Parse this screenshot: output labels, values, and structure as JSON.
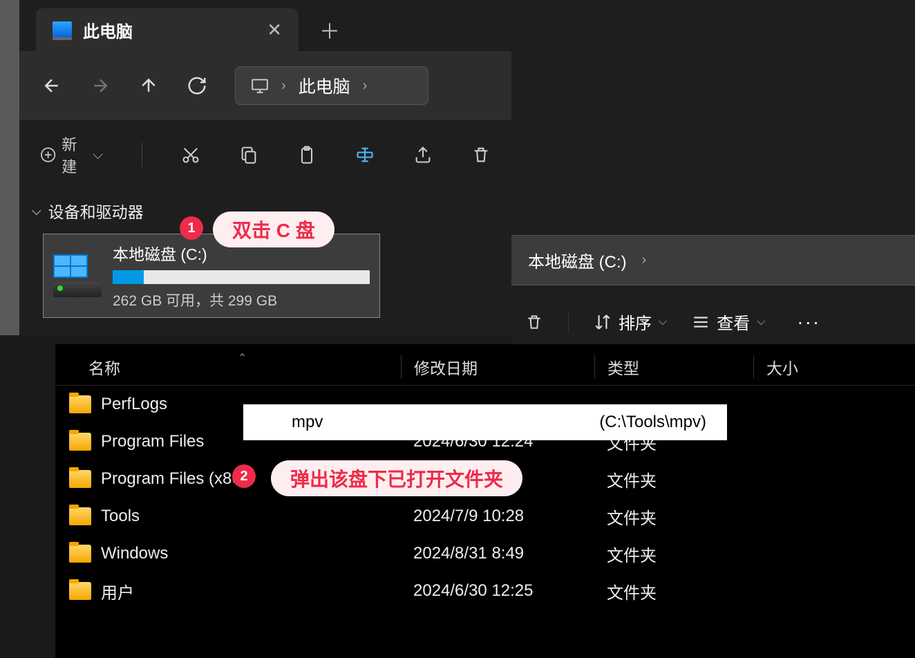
{
  "window1": {
    "tab_title": "此电脑",
    "breadcrumb": "此电脑",
    "toolbar": {
      "new_label": "新建"
    },
    "section_label": "设备和驱动器",
    "drive": {
      "name": "本地磁盘 (C:)",
      "subtitle": "262 GB 可用，共 299 GB"
    }
  },
  "window2": {
    "breadcrumb": "本地磁盘 (C:)",
    "toolbar": {
      "sort_label": "排序",
      "view_label": "查看"
    },
    "columns": {
      "name": "名称",
      "date": "修改日期",
      "type": "类型",
      "size": "大小"
    },
    "files": [
      {
        "name": "PerfLogs",
        "date": "",
        "type": ""
      },
      {
        "name": "Program Files",
        "date": "2024/6/30 12:24",
        "type": "文件夹"
      },
      {
        "name": "Program Files (x86)",
        "date": "",
        "type": "文件夹"
      },
      {
        "name": "Tools",
        "date": "2024/7/9 10:28",
        "type": "文件夹"
      },
      {
        "name": "Windows",
        "date": "2024/8/31 8:49",
        "type": "文件夹"
      },
      {
        "name": "用户",
        "date": "2024/6/30 12:25",
        "type": "文件夹"
      }
    ],
    "popup": {
      "name": "mpv",
      "path": "(C:\\Tools\\mpv)"
    }
  },
  "annotations": {
    "step1_num": "1",
    "step1_text": "双击 C 盘",
    "step2_num": "2",
    "step2_text": "弹出该盘下已打开文件夹"
  }
}
